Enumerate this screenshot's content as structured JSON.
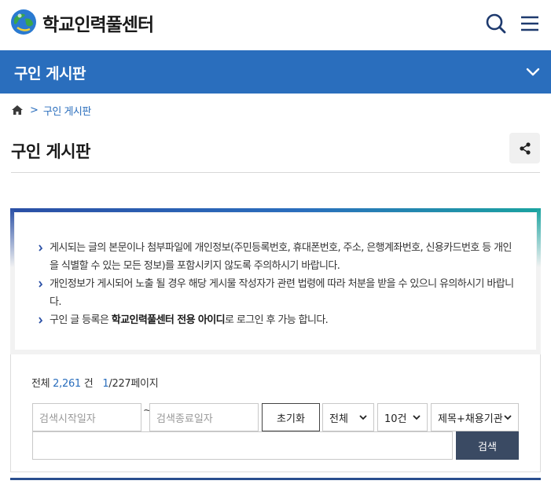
{
  "header": {
    "site_title": "학교인력풀센터",
    "logo_icon": "globe-logo-icon",
    "search_icon": "search-icon",
    "menu_icon": "hamburger-menu-icon"
  },
  "nav": {
    "title": "구인 게시판",
    "chevron_icon": "chevron-down-icon",
    "background": "#2a6ebd"
  },
  "breadcrumb": {
    "home_icon": "home-icon",
    "separator": ">",
    "current": "구인 게시판"
  },
  "page": {
    "title": "구인 게시판",
    "share_icon": "share-icon"
  },
  "notice": {
    "items": [
      "게시되는 글의 본문이나 첨부파일에 개인정보(주민등록번호, 휴대폰번호, 주소, 은행계좌번호, 신용카드번호 등 개인을 식별할 수 있는 모든 정보)를 포함시키지 않도록 주의하시기 바랍니다.",
      "개인정보가 게시되어 노출 될 경우 해당 게시물 작성자가 관련 법령에 따라 처분을 받을 수 있으니 유의하시기 바랍니다."
    ],
    "item3_prefix": "구인 글 등록은 ",
    "item3_bold": "학교인력풀센터 전용 아이디",
    "item3_suffix": "로 로그인 후 가능 합니다."
  },
  "search": {
    "total_label": "전체",
    "total_count": "2,261",
    "total_unit": "건",
    "page_current": "1",
    "page_sep": "/227페이지",
    "date_start_placeholder": "검색시작일자",
    "date_tilde": "~",
    "date_end_placeholder": "검색종료일자",
    "reset_label": "초기화",
    "select_scope": "전체",
    "select_rows": "10건",
    "select_field": "제목+채용기관",
    "keyword_value": "",
    "submit_label": "검색"
  }
}
